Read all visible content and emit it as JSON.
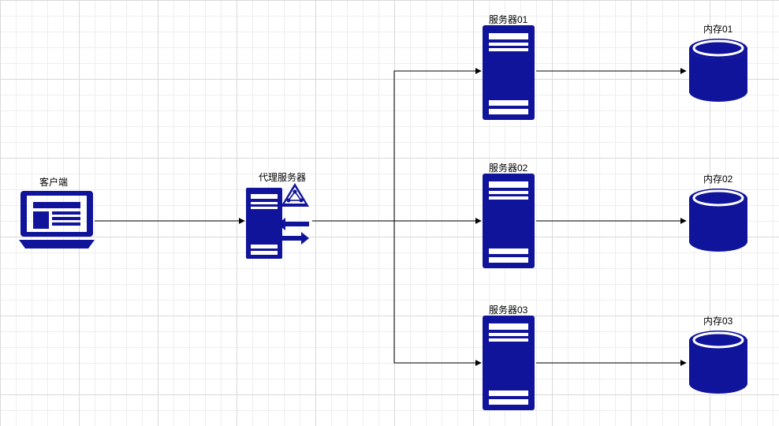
{
  "labels": {
    "client": "客户端",
    "proxy": "代理服务器",
    "server01": "服务器01",
    "server02": "服务器02",
    "server03": "服务器03",
    "storage01": "内存01",
    "storage02": "内存02",
    "storage03": "内存03"
  },
  "colors": {
    "shape": "#10149A",
    "stroke": "#000000"
  },
  "diagram": {
    "type": "network-architecture",
    "flow": [
      {
        "from": "client",
        "to": "proxy"
      },
      {
        "from": "proxy",
        "to": "server01"
      },
      {
        "from": "proxy",
        "to": "server02"
      },
      {
        "from": "proxy",
        "to": "server03"
      },
      {
        "from": "server01",
        "to": "storage01"
      },
      {
        "from": "server02",
        "to": "storage02"
      },
      {
        "from": "server03",
        "to": "storage03"
      }
    ]
  }
}
